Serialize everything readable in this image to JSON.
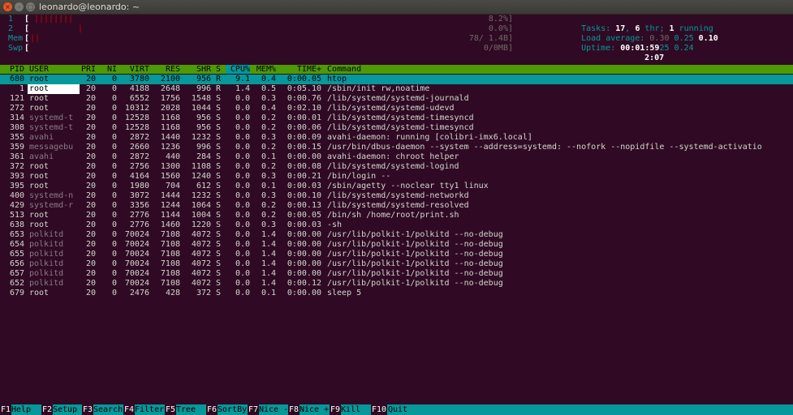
{
  "window": {
    "title": "leonardo@leonardo: ~"
  },
  "meters": {
    "cpu1": {
      "label": "1",
      "open": "[",
      "bars": "||||||||",
      "value": "8.2%]"
    },
    "cpu2": {
      "label": "2",
      "open": "[",
      "bars": "|",
      "value": "0.0%]"
    },
    "mem": {
      "label": "Mem",
      "open": "[",
      "bars": "||",
      "value": "78/ 1.4B]"
    },
    "swp": {
      "label": "Swp",
      "open": "[",
      "bars": "",
      "value": "0/0MB]"
    }
  },
  "summary": {
    "tasks_label": "Tasks:",
    "tasks": "17",
    "thr_sep": ",",
    "threads": "6",
    "thr_label": "thr;",
    "running": "1",
    "running_label": "running",
    "load_label": "Load average:",
    "load1": "0.30",
    "load5": "0.25",
    "load15": "0.10",
    "uptime_label": "Uptime:",
    "uptime": "00:01:59",
    "uptime_extra": "25 0.24",
    "extra_line": "2:07"
  },
  "columns": [
    "PID",
    "USER",
    "PRI",
    "NI",
    "VIRT",
    "RES",
    "SHR",
    "S",
    "CPU%",
    "MEM%",
    "TIME+",
    "Command"
  ],
  "processes": [
    {
      "pid": "680",
      "user": "root",
      "pri": "20",
      "ni": "0",
      "virt": "3780",
      "res": "2100",
      "shr": "956",
      "s": "R",
      "cpu": "9.1",
      "mem": "0.4",
      "time": "0:00.05",
      "cmd": "htop"
    },
    {
      "pid": "1",
      "user": "root",
      "pri": "20",
      "ni": "0",
      "virt": "4188",
      "res": "2648",
      "shr": "996",
      "s": "R",
      "cpu": "1.4",
      "mem": "0.5",
      "time": "0:05.10",
      "cmd": "/sbin/init rw,noatime"
    },
    {
      "pid": "121",
      "user": "root",
      "pri": "20",
      "ni": "0",
      "virt": "6552",
      "res": "1756",
      "shr": "1548",
      "s": "S",
      "cpu": "0.0",
      "mem": "0.3",
      "time": "0:00.76",
      "cmd": "/lib/systemd/systemd-journald"
    },
    {
      "pid": "272",
      "user": "root",
      "pri": "20",
      "ni": "0",
      "virt": "10312",
      "res": "2028",
      "shr": "1044",
      "s": "S",
      "cpu": "0.0",
      "mem": "0.4",
      "time": "0:02.10",
      "cmd": "/lib/systemd/systemd-udevd"
    },
    {
      "pid": "314",
      "user": "systemd-t",
      "pri": "20",
      "ni": "0",
      "virt": "12528",
      "res": "1168",
      "shr": "956",
      "s": "S",
      "cpu": "0.0",
      "mem": "0.2",
      "time": "0:00.01",
      "cmd": "/lib/systemd/systemd-timesyncd"
    },
    {
      "pid": "308",
      "user": "systemd-t",
      "pri": "20",
      "ni": "0",
      "virt": "12528",
      "res": "1168",
      "shr": "956",
      "s": "S",
      "cpu": "0.0",
      "mem": "0.2",
      "time": "0:00.06",
      "cmd": "/lib/systemd/systemd-timesyncd"
    },
    {
      "pid": "355",
      "user": "avahi",
      "pri": "20",
      "ni": "0",
      "virt": "2872",
      "res": "1440",
      "shr": "1232",
      "s": "S",
      "cpu": "0.0",
      "mem": "0.3",
      "time": "0:00.09",
      "cmd": "avahi-daemon: running [colibri-imx6.local]"
    },
    {
      "pid": "359",
      "user": "messagebu",
      "pri": "20",
      "ni": "0",
      "virt": "2660",
      "res": "1236",
      "shr": "996",
      "s": "S",
      "cpu": "0.0",
      "mem": "0.2",
      "time": "0:00.15",
      "cmd": "/usr/bin/dbus-daemon --system --address=systemd: --nofork --nopidfile --systemd-activatio"
    },
    {
      "pid": "361",
      "user": "avahi",
      "pri": "20",
      "ni": "0",
      "virt": "2872",
      "res": "440",
      "shr": "284",
      "s": "S",
      "cpu": "0.0",
      "mem": "0.1",
      "time": "0:00.00",
      "cmd": "avahi-daemon: chroot helper"
    },
    {
      "pid": "372",
      "user": "root",
      "pri": "20",
      "ni": "0",
      "virt": "2756",
      "res": "1300",
      "shr": "1108",
      "s": "S",
      "cpu": "0.0",
      "mem": "0.2",
      "time": "0:00.08",
      "cmd": "/lib/systemd/systemd-logind"
    },
    {
      "pid": "393",
      "user": "root",
      "pri": "20",
      "ni": "0",
      "virt": "4164",
      "res": "1560",
      "shr": "1240",
      "s": "S",
      "cpu": "0.0",
      "mem": "0.3",
      "time": "0:00.21",
      "cmd": "/bin/login --"
    },
    {
      "pid": "395",
      "user": "root",
      "pri": "20",
      "ni": "0",
      "virt": "1980",
      "res": "704",
      "shr": "612",
      "s": "S",
      "cpu": "0.0",
      "mem": "0.1",
      "time": "0:00.03",
      "cmd": "/sbin/agetty --noclear tty1 linux"
    },
    {
      "pid": "400",
      "user": "systemd-n",
      "pri": "20",
      "ni": "0",
      "virt": "3072",
      "res": "1444",
      "shr": "1232",
      "s": "S",
      "cpu": "0.0",
      "mem": "0.3",
      "time": "0:00.10",
      "cmd": "/lib/systemd/systemd-networkd"
    },
    {
      "pid": "429",
      "user": "systemd-r",
      "pri": "20",
      "ni": "0",
      "virt": "3356",
      "res": "1244",
      "shr": "1064",
      "s": "S",
      "cpu": "0.0",
      "mem": "0.2",
      "time": "0:00.13",
      "cmd": "/lib/systemd/systemd-resolved"
    },
    {
      "pid": "513",
      "user": "root",
      "pri": "20",
      "ni": "0",
      "virt": "2776",
      "res": "1144",
      "shr": "1004",
      "s": "S",
      "cpu": "0.0",
      "mem": "0.2",
      "time": "0:00.05",
      "cmd": "/bin/sh /home/root/print.sh"
    },
    {
      "pid": "638",
      "user": "root",
      "pri": "20",
      "ni": "0",
      "virt": "2776",
      "res": "1460",
      "shr": "1220",
      "s": "S",
      "cpu": "0.0",
      "mem": "0.3",
      "time": "0:00.03",
      "cmd": "-sh"
    },
    {
      "pid": "653",
      "user": "polkitd",
      "pri": "20",
      "ni": "0",
      "virt": "70024",
      "res": "7108",
      "shr": "4072",
      "s": "S",
      "cpu": "0.0",
      "mem": "1.4",
      "time": "0:00.00",
      "cmd": "/usr/lib/polkit-1/polkitd --no-debug"
    },
    {
      "pid": "654",
      "user": "polkitd",
      "pri": "20",
      "ni": "0",
      "virt": "70024",
      "res": "7108",
      "shr": "4072",
      "s": "S",
      "cpu": "0.0",
      "mem": "1.4",
      "time": "0:00.00",
      "cmd": "/usr/lib/polkit-1/polkitd --no-debug"
    },
    {
      "pid": "655",
      "user": "polkitd",
      "pri": "20",
      "ni": "0",
      "virt": "70024",
      "res": "7108",
      "shr": "4072",
      "s": "S",
      "cpu": "0.0",
      "mem": "1.4",
      "time": "0:00.00",
      "cmd": "/usr/lib/polkit-1/polkitd --no-debug"
    },
    {
      "pid": "656",
      "user": "polkitd",
      "pri": "20",
      "ni": "0",
      "virt": "70024",
      "res": "7108",
      "shr": "4072",
      "s": "S",
      "cpu": "0.0",
      "mem": "1.4",
      "time": "0:00.00",
      "cmd": "/usr/lib/polkit-1/polkitd --no-debug"
    },
    {
      "pid": "657",
      "user": "polkitd",
      "pri": "20",
      "ni": "0",
      "virt": "70024",
      "res": "7108",
      "shr": "4072",
      "s": "S",
      "cpu": "0.0",
      "mem": "1.4",
      "time": "0:00.00",
      "cmd": "/usr/lib/polkit-1/polkitd --no-debug"
    },
    {
      "pid": "652",
      "user": "polkitd",
      "pri": "20",
      "ni": "0",
      "virt": "70024",
      "res": "7108",
      "shr": "4072",
      "s": "S",
      "cpu": "0.0",
      "mem": "1.4",
      "time": "0:00.12",
      "cmd": "/usr/lib/polkit-1/polkitd --no-debug"
    },
    {
      "pid": "679",
      "user": "root",
      "pri": "20",
      "ni": "0",
      "virt": "2476",
      "res": "428",
      "shr": "372",
      "s": "S",
      "cpu": "0.0",
      "mem": "0.1",
      "time": "0:00.00",
      "cmd": "sleep 5"
    }
  ],
  "fkeys": [
    {
      "key": "F1",
      "label": "Help"
    },
    {
      "key": "F2",
      "label": "Setup"
    },
    {
      "key": "F3",
      "label": "Search"
    },
    {
      "key": "F4",
      "label": "Filter"
    },
    {
      "key": "F5",
      "label": "Tree"
    },
    {
      "key": "F6",
      "label": "SortBy"
    },
    {
      "key": "F7",
      "label": "Nice -"
    },
    {
      "key": "F8",
      "label": "Nice +"
    },
    {
      "key": "F9",
      "label": "Kill"
    },
    {
      "key": "F10",
      "label": "Quit"
    }
  ],
  "colors": {
    "background": "#300a24",
    "header": "#4e9a06",
    "selection": "#06989a",
    "accent": "#e95420"
  }
}
